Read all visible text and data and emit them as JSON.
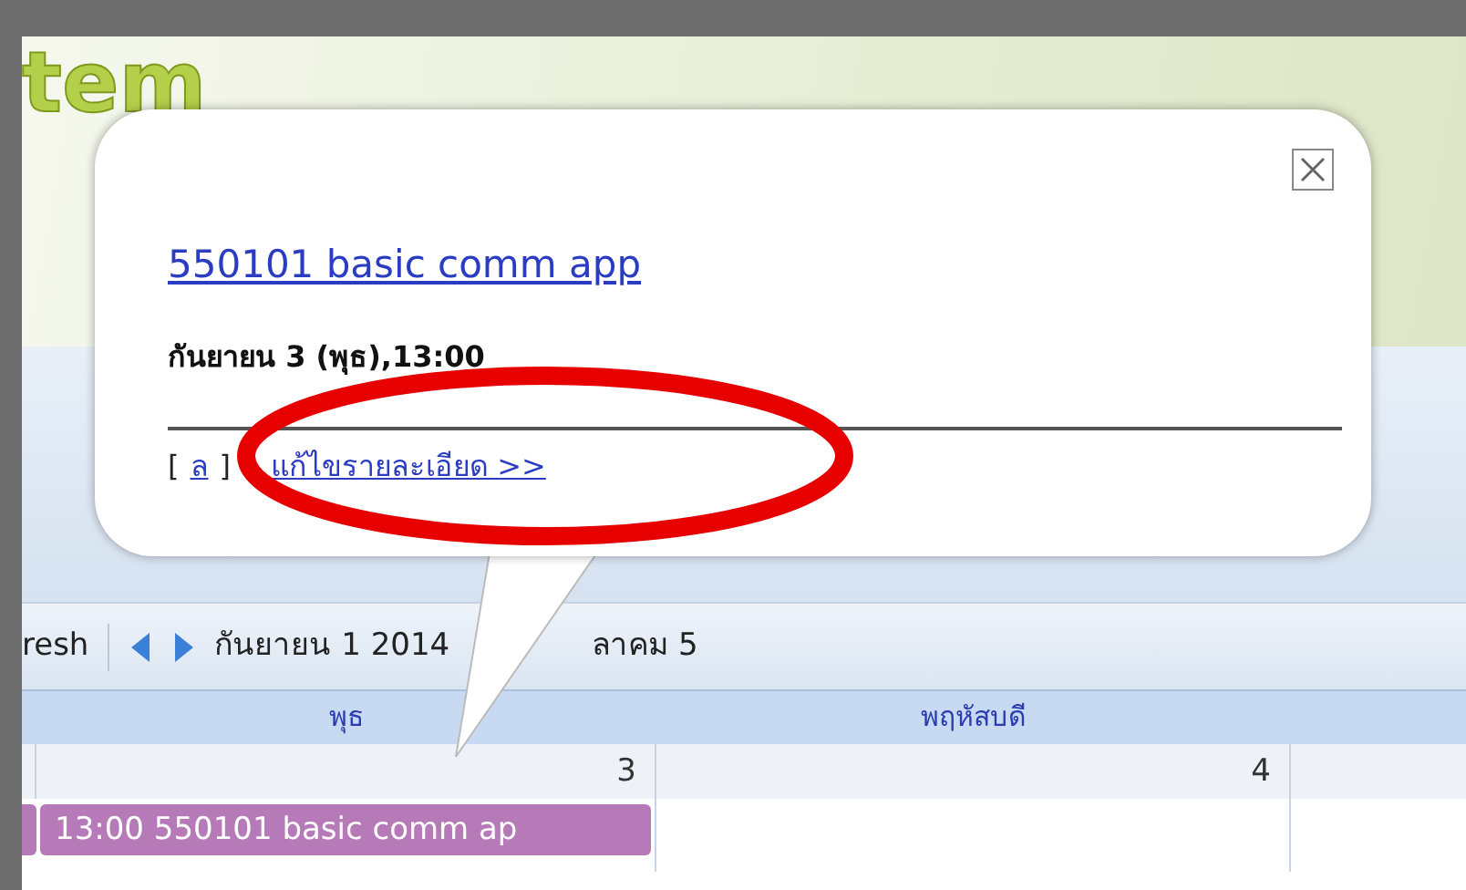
{
  "app_logo": "tem",
  "toolbar": {
    "refresh_label": "resh",
    "range_start": "กันยายน 1 2014",
    "range_end": "ลาคม 5"
  },
  "columns": [
    {
      "header": "พุธ",
      "day": "3",
      "events": [
        "13:00 550101 basic comm ap"
      ]
    },
    {
      "header": "พฤหัสบดี",
      "day": "4"
    }
  ],
  "popup": {
    "title": "550101 basic comm app",
    "when": "กันยายน 3 (พุธ),13:00",
    "bracket_open": "[",
    "delete_link": "ล",
    "bracket_close": "]",
    "edit_link": "แก้ไขรายละเอียด >>"
  },
  "annotation": {
    "kind": "ellipse"
  }
}
